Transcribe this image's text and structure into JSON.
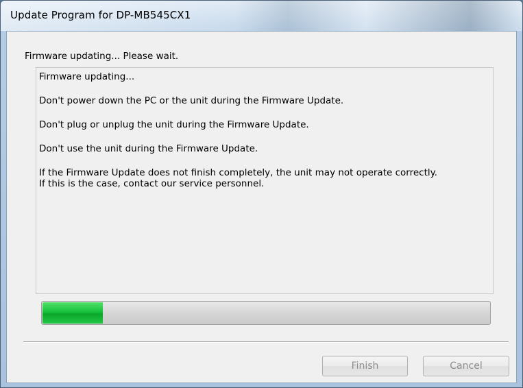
{
  "window": {
    "title": "Update Program for DP-MB545CX1"
  },
  "status": {
    "label": "Firmware updating... Please wait."
  },
  "messages": [
    "Firmware updating...",
    "Don't power down the PC or the unit during the Firmware Update.",
    "Don't plug or unplug the unit during the Firmware Update.",
    "Don't use the unit during the Firmware Update.",
    "If the Firmware Update does not finish completely, the unit may not operate correctly.",
    "If this is the case, contact our service personnel."
  ],
  "progress": {
    "fraction": 0.135,
    "color": "#17c23c"
  },
  "buttons": {
    "finish_label": "Finish",
    "cancel_label": "Cancel"
  }
}
